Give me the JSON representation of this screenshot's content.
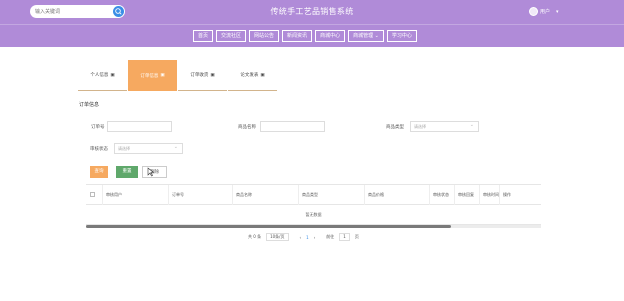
{
  "header": {
    "search_placeholder": "输入关键词",
    "site_title": "传统手工艺品销售系统",
    "user_label": "用户",
    "user_caret": "▾"
  },
  "nav": {
    "items": [
      {
        "label": "首页"
      },
      {
        "label": "交流社区"
      },
      {
        "label": "网站公告"
      },
      {
        "label": "新闻资讯"
      },
      {
        "label": "商城中心"
      },
      {
        "label": "商城管理 ⌄"
      },
      {
        "label": "学习中心"
      }
    ]
  },
  "tabs": [
    {
      "label": "个人信息"
    },
    {
      "label": "订单信息"
    },
    {
      "label": "订单收货"
    },
    {
      "label": "论文发表"
    }
  ],
  "section_title": "订单信息",
  "filters": {
    "order_no_label": "订单号",
    "product_label": "商品名称",
    "product_type_label": "商品类型",
    "product_type_placeholder": "请选择",
    "audit_label": "审核状态",
    "audit_placeholder": "请选择"
  },
  "buttons": {
    "query": "查询",
    "reset": "重置",
    "delete": "删除"
  },
  "table": {
    "columns": [
      "审核用户",
      "订单号",
      "商品名称",
      "商品类型",
      "商品价格",
      "审核状态",
      "审核回复",
      "审核时间",
      "操作"
    ],
    "empty_text": "暂无数据"
  },
  "pager": {
    "total": "共 0 条",
    "page_size": "10条/页",
    "prev": "‹",
    "current": "1",
    "next": "›",
    "goto_label": "前往",
    "goto_value": "1",
    "page_suffix": "页"
  },
  "colors": {
    "primary": "#b08bd8",
    "accent": "#f6a960",
    "reset_button": "#5fa86b",
    "link_blue": "#3a8ee6"
  }
}
